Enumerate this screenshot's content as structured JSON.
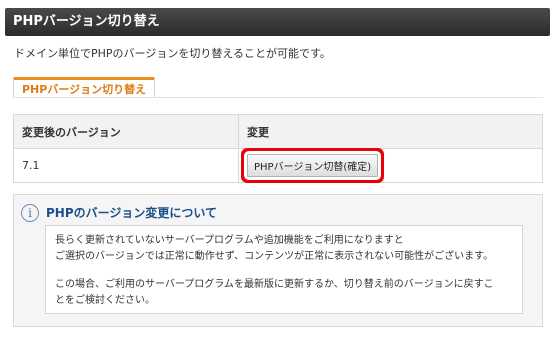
{
  "header": {
    "title": "PHPバージョン切り替え"
  },
  "description": "ドメイン単位でPHPのバージョンを切り替えることが可能です。",
  "tab": {
    "label": "PHPバージョン切り替え"
  },
  "table": {
    "columns": [
      "変更後のバージョン",
      "変更"
    ],
    "rows": [
      {
        "version": "7.1",
        "button_label": "PHPバージョン切替(確定)"
      }
    ]
  },
  "info": {
    "icon": "info-icon",
    "title": "PHPのバージョン変更について",
    "lines": [
      "長らく更新されていないサーバープログラムや追加機能をご利用になりますと",
      "ご選択のバージョンでは正常に動作せず、コンテンツが正常に表示されない可能性がございます。",
      "この場合、ご利用のサーバープログラムを最新版に更新するか、切り替え前のバージョンに戻すこ",
      "とをご検討ください。"
    ]
  },
  "colors": {
    "accent_orange": "#f08c1e",
    "highlight_red": "#e8000b",
    "title_blue": "#1a4f8b"
  }
}
